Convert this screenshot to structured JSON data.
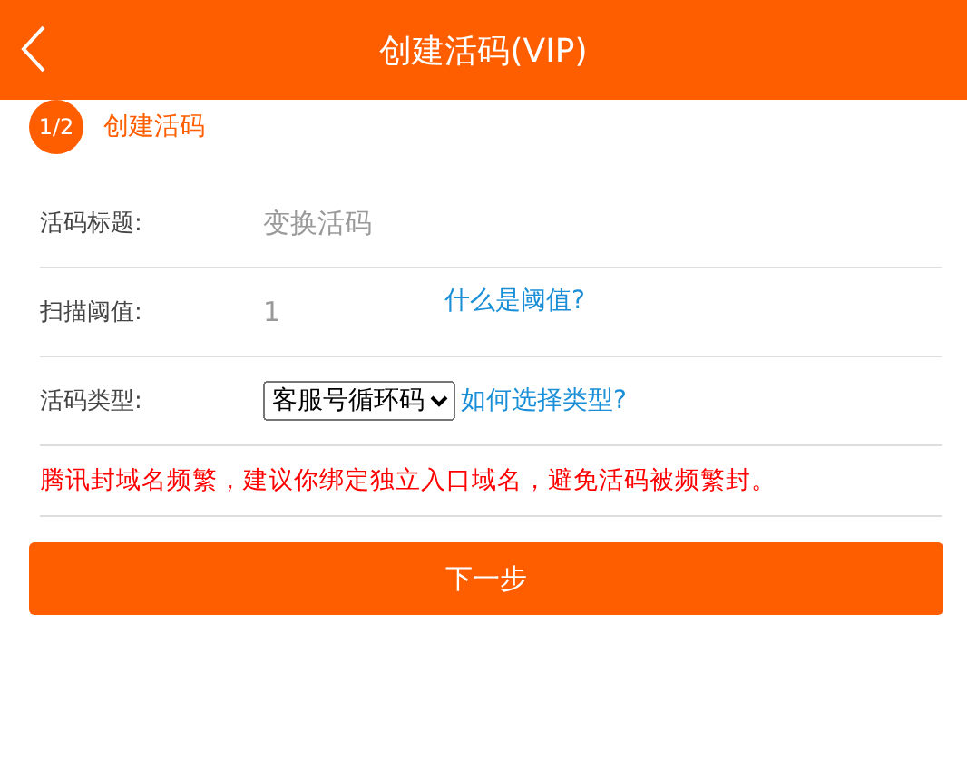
{
  "header": {
    "title": "创建活码(VIP)"
  },
  "step": {
    "badge": "1/2",
    "label": "创建活码"
  },
  "form": [
    {
      "kind": "text",
      "label": "活码标题:",
      "placeholder": "变换活码"
    },
    {
      "kind": "text",
      "label": "扫描阈值:",
      "placeholder": "1",
      "link": "什么是阈值?"
    },
    {
      "kind": "select",
      "label": "活码类型:",
      "value": "客服号循环码",
      "link": "如何选择类型?"
    }
  ],
  "warning": "腾讯封域名频繁，建议你绑定独立入口域名，避免活码被频繁封。",
  "button": "下一步"
}
